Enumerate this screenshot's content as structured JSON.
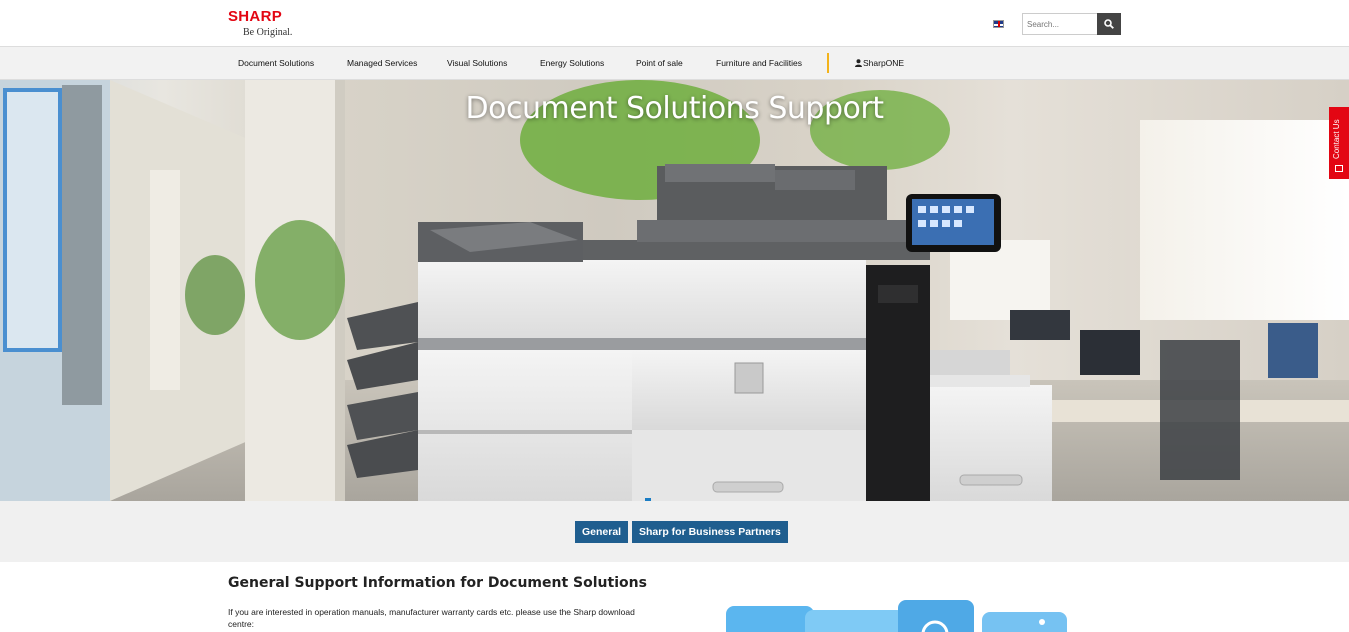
{
  "brand": {
    "name": "SHARP",
    "tagline": "Be Original.",
    "color": "#e30613"
  },
  "header": {
    "language_icon": "uk-flag-icon",
    "search": {
      "placeholder": "Search...",
      "value": "",
      "button_icon": "search-icon"
    }
  },
  "nav": {
    "items": [
      {
        "label": "Document Solutions"
      },
      {
        "label": "Managed Services"
      },
      {
        "label": "Visual Solutions"
      },
      {
        "label": "Energy Solutions"
      },
      {
        "label": "Point of sale"
      },
      {
        "label": "Furniture and Facilities"
      },
      {
        "label": "SharpONE",
        "icon": "user-icon"
      }
    ],
    "separator_color": "#f3b31b"
  },
  "hero": {
    "title": "Document Solutions Support",
    "slide_indicator_color": "#1b7dc4"
  },
  "contact_tab": {
    "label": "Contact Us",
    "icon": "mail-icon",
    "color": "#e30613"
  },
  "tabs": [
    {
      "label": "General"
    },
    {
      "label": "Sharp for Business Partners"
    }
  ],
  "tab_color": "#1f5e8f",
  "content": {
    "title": "General Support Information for Document Solutions",
    "text": "If you are interested in operation manuals, manufacturer warranty cards etc. please use the Sharp download centre:"
  }
}
